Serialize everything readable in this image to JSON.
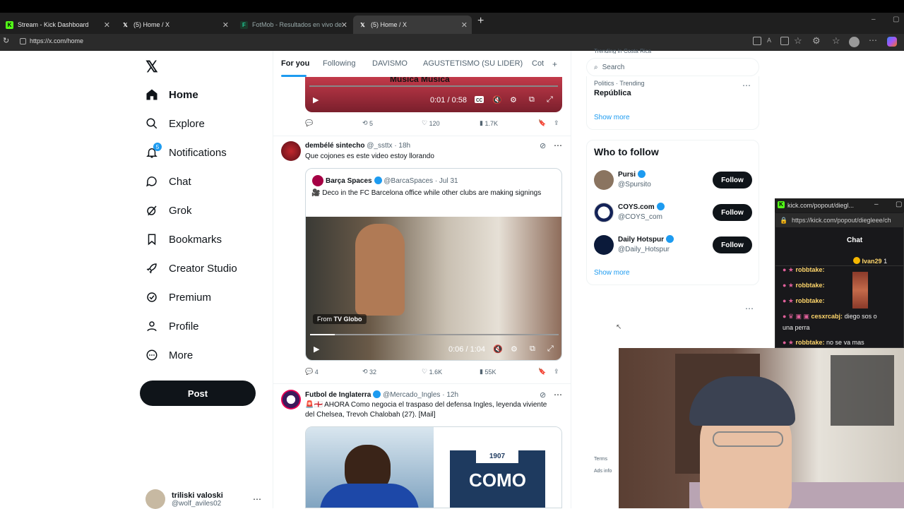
{
  "browser": {
    "tabs": [
      {
        "title": "Stream - Kick Dashboard",
        "favicon": "kick-icon"
      },
      {
        "title": "(5) Home / X",
        "favicon": "x-icon"
      },
      {
        "title": "FotMob - Resultados en vivo de fú",
        "favicon": "fotmob-icon"
      },
      {
        "title": "(5) Home / X",
        "favicon": "x-icon"
      }
    ],
    "new_tab": "+",
    "url": "https://x.com/home"
  },
  "nav": {
    "logo": "𝕏",
    "items": [
      {
        "label": "Home",
        "icon": "home-icon"
      },
      {
        "label": "Explore",
        "icon": "search-icon"
      },
      {
        "label": "Notifications",
        "icon": "bell-icon",
        "badge": "5"
      },
      {
        "label": "Chat",
        "icon": "chat-icon"
      },
      {
        "label": "Grok",
        "icon": "grok-icon"
      },
      {
        "label": "Bookmarks",
        "icon": "bookmark-icon"
      },
      {
        "label": "Creator Studio",
        "icon": "rocket-icon"
      },
      {
        "label": "Premium",
        "icon": "premium-icon"
      },
      {
        "label": "Profile",
        "icon": "profile-icon"
      },
      {
        "label": "More",
        "icon": "more-icon"
      }
    ],
    "post": "Post",
    "account": {
      "name": "triliski valoski",
      "handle": "@wolf_aviles02"
    }
  },
  "timeline": {
    "tabs": [
      "For you",
      "Following",
      "DAVISMO",
      "AGUSTETISMO (SU LIDER)",
      "Cot"
    ],
    "video1": {
      "overlay_text": "Musica Musica",
      "time": "0:01 / 0:58"
    },
    "tweet1_stats": {
      "replies": "",
      "reposts": "5",
      "likes": "120",
      "views": "1.7K"
    },
    "tweet2": {
      "name": "dembélé sintecho",
      "handle": "@_ssttx",
      "time": "· 18h",
      "text": "Que cojones es este video estoy llorando",
      "quote": {
        "name": "Barça Spaces",
        "handle": "@BarcaSpaces",
        "time": "· Jul 31",
        "text": "🎥 Deco in the FC Barcelona office while other clubs are making signings",
        "from": "From",
        "source": "TV Globo",
        "video_time": "0:06 / 1:04"
      },
      "stats": {
        "replies": "4",
        "reposts": "32",
        "likes": "1.6K",
        "views": "55K"
      }
    },
    "tweet3": {
      "name": "Futbol de Inglaterra",
      "handle": "@Mercado_Ingles",
      "time": "· 12h",
      "text": "🚨🏴󠁧󠁢󠁥󠁮󠁧󠁿 AHORA Como negocia el traspaso del defensa Ingles, leyenda viviente del Chelsea, Trevoh Chalobah (27). [Mail]",
      "image_text_year": "1907",
      "image_text_club": "COMO"
    }
  },
  "sidebar": {
    "search_placeholder": "Search",
    "trend_above": "Trending in Costa Rica",
    "trend": {
      "category": "Politics · Trending",
      "name": "República"
    },
    "show_more": "Show more",
    "who_to_follow": "Who to follow",
    "suggestions": [
      {
        "name": "Pursi",
        "handle": "@Spursito"
      },
      {
        "name": "COYS.com",
        "handle": "@COYS_com"
      },
      {
        "name": "Daily Hotspur",
        "handle": "@Daily_Hotspur"
      }
    ],
    "follow_label": "Follow",
    "show_more2": "Show more",
    "footer_terms": "Terms",
    "footer_ads": "Ads info"
  },
  "popout": {
    "title": "kick.com/popout/diegl...",
    "url": "https://kick.com/popout/diegleee/ch",
    "chat_label": "Chat",
    "pinned_user": "Ivan29",
    "pinned_count": "1",
    "messages": [
      {
        "user": "robbtake:",
        "text": ""
      },
      {
        "user": "robbtake:",
        "text": ""
      },
      {
        "user": "robbtake:",
        "text": ""
      },
      {
        "user": "cesxrcabj:",
        "text": "diego sos o"
      },
      {
        "user": "",
        "text": "una perra"
      },
      {
        "user": "robbtake:",
        "text": "no se va mas"
      }
    ]
  },
  "colors": {
    "x_blue": "#1d9bf0",
    "kick_green": "#53fc18",
    "text_primary": "#0f1419",
    "text_secondary": "#536471"
  }
}
